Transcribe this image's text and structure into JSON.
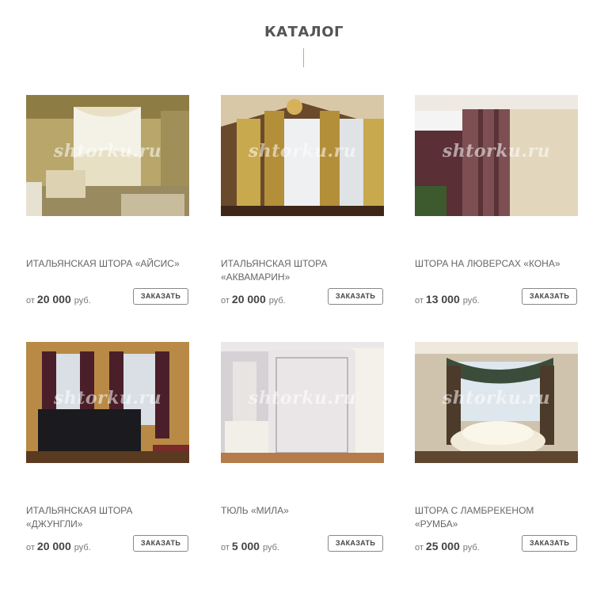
{
  "catalog": {
    "title": "КАТАЛОГ",
    "watermark": "shtorku.ru",
    "price_prefix": "от",
    "currency": "руб.",
    "order_label": "ЗАКАЗАТЬ",
    "accent_color": "#b8b860",
    "items": [
      {
        "title": "ИТАЛЬЯНСКАЯ ШТОРА «АЙСИС»",
        "price": "20 000"
      },
      {
        "title": "ИТАЛЬЯНСКАЯ ШТОРА «АКВАМАРИН»",
        "price": "20 000"
      },
      {
        "title": "ШТОРА НА ЛЮВЕРСАХ «КОНА»",
        "price": "13 000"
      },
      {
        "title": "ИТАЛЬЯНСКАЯ ШТОРА «ДЖУНГЛИ»",
        "price": "20 000"
      },
      {
        "title": "ТЮЛЬ «МИЛА»",
        "price": "5 000"
      },
      {
        "title": "ШТОРА С ЛАМБРЕКЕНОМ «РУМБА»",
        "price": "25 000"
      }
    ]
  }
}
